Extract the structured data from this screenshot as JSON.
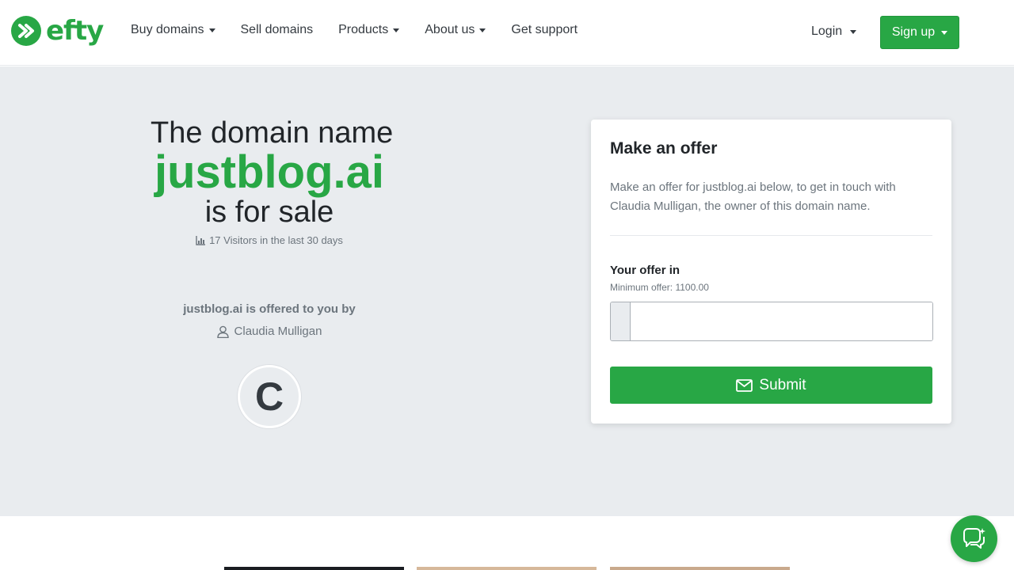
{
  "brand": {
    "name": "efty",
    "color": "#28a745"
  },
  "nav": {
    "items": [
      {
        "label": "Buy domains",
        "dropdown": true
      },
      {
        "label": "Sell domains",
        "dropdown": false
      },
      {
        "label": "Products",
        "dropdown": true
      },
      {
        "label": "About us",
        "dropdown": true
      },
      {
        "label": "Get support",
        "dropdown": false
      }
    ],
    "login_label": "Login",
    "signup_label": "Sign up"
  },
  "hero": {
    "line1": "The domain name",
    "domain": "justblog.ai",
    "line3": "is for sale",
    "visitors": "17 Visitors in the last 30 days",
    "offered_by": "justblog.ai is offered to you by",
    "owner_name": "Claudia Mulligan",
    "avatar_initial": "C"
  },
  "offer_card": {
    "title": "Make an offer",
    "description": "Make an offer for justblog.ai below, to get in touch with Claudia Mulligan, the owner of this domain name.",
    "offer_label": "Your offer in",
    "min_offer": "Minimum offer: 1100.00",
    "input_value": "",
    "input_placeholder": "",
    "submit_label": "Submit"
  },
  "icons": {
    "visitors": "bar-chart-icon",
    "owner": "user-icon",
    "submit": "envelope-icon",
    "chat": "chat-icon"
  },
  "colors": {
    "accent": "#28a745",
    "hero_bg": "#e9ecef",
    "text_muted": "#6c757d"
  }
}
